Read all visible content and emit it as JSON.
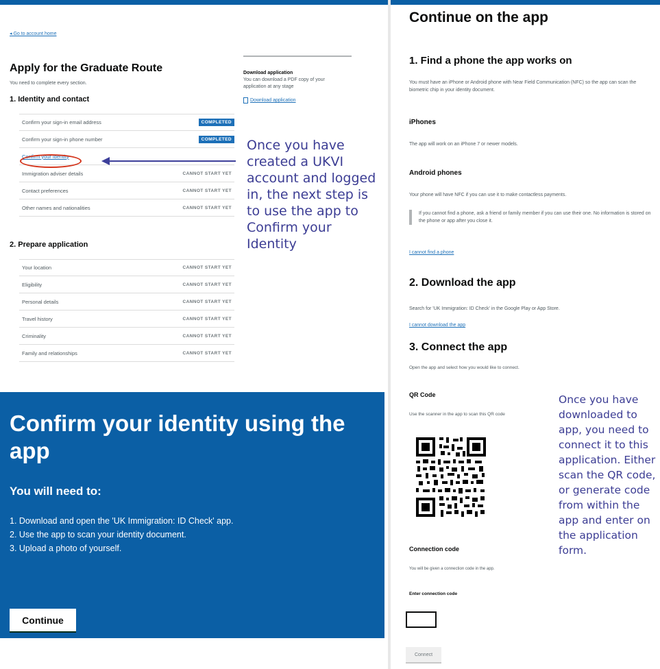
{
  "app_overview": {
    "back_link": "◂ Go to account home",
    "title": "Apply for the Graduate Route",
    "intro": "You need to complete every section.",
    "section1_title": "1. Identity and contact",
    "section1_tasks": [
      {
        "name": "Confirm your sign-in email address",
        "status": "COMPLETED"
      },
      {
        "name": "Confirm your sign-in phone number",
        "status": "COMPLETED"
      },
      {
        "name": "Confirm your identity",
        "status": ""
      },
      {
        "name": "Immigration adviser details",
        "status": "CANNOT START YET"
      },
      {
        "name": "Contact preferences",
        "status": "CANNOT START YET"
      },
      {
        "name": "Other names and nationalities",
        "status": "CANNOT START YET"
      }
    ],
    "section2_title": "2. Prepare application",
    "section2_tasks": [
      {
        "name": "Your location",
        "status": "CANNOT START YET"
      },
      {
        "name": "Eligibility",
        "status": "CANNOT START YET"
      },
      {
        "name": "Personal details",
        "status": "CANNOT START YET"
      },
      {
        "name": "Travel history",
        "status": "CANNOT START YET"
      },
      {
        "name": "Criminality",
        "status": "CANNOT START YET"
      },
      {
        "name": "Family and relationships",
        "status": "CANNOT START YET"
      }
    ],
    "download": {
      "title": "Download application",
      "text": "You can download a PDF copy of your application at any stage",
      "link": "Download application"
    },
    "annotation": "Once you have created a UKVI account and logged in, the next step is to use the app to Confirm your Identity"
  },
  "confirm_panel": {
    "title": "Confirm your identity using the app",
    "subtitle": "You will need to:",
    "steps": [
      "1. Download and open the 'UK Immigration: ID Check' app.",
      "2. Use the app to scan your identity document.",
      "3. Upload a photo of yourself."
    ],
    "button": "Continue"
  },
  "continue_app": {
    "title": "Continue on the app",
    "step1_title": "1. Find a phone the app works on",
    "step1_text": "You must have an iPhone or Android phone with Near Field Communication (NFC) so the app can scan the biometric chip in your identity document.",
    "iphones_title": "iPhones",
    "iphones_text": "The app will work on an iPhone 7 or newer models.",
    "android_title": "Android phones",
    "android_text": "Your phone will have NFC if you can use it to make contactless payments.",
    "inset_text": "If you cannot find a phone, ask a friend or family member if you can use their one. No information is stored on the phone or app after you close it.",
    "no_phone_link": "I cannot find a phone",
    "step2_title": "2. Download the app",
    "step2_text": "Search for 'UK Immigration: ID Check' in the Google Play or App Store.",
    "no_download_link": "I cannot download the app",
    "step3_title": "3. Connect the app",
    "step3_text": "Open the app and select how you would like to connect.",
    "qr_title": "QR Code",
    "qr_text": "Use the scanner in the app to scan this QR code",
    "conn_title": "Connection code",
    "conn_text": "You will be given a connection code in the app.",
    "input_label": "Enter connection code",
    "input_value": "",
    "connect_button": "Connect",
    "annotation": "Once you have downloaded to app, you need to connect it to this application. Either scan the QR code, or generate code from within the app and enter on the application form."
  },
  "colors": {
    "gov_blue": "#0b5fa5",
    "link_blue": "#1d70b8",
    "annotation_purple": "#3c3d94",
    "highlight_red": "#d4351c"
  }
}
